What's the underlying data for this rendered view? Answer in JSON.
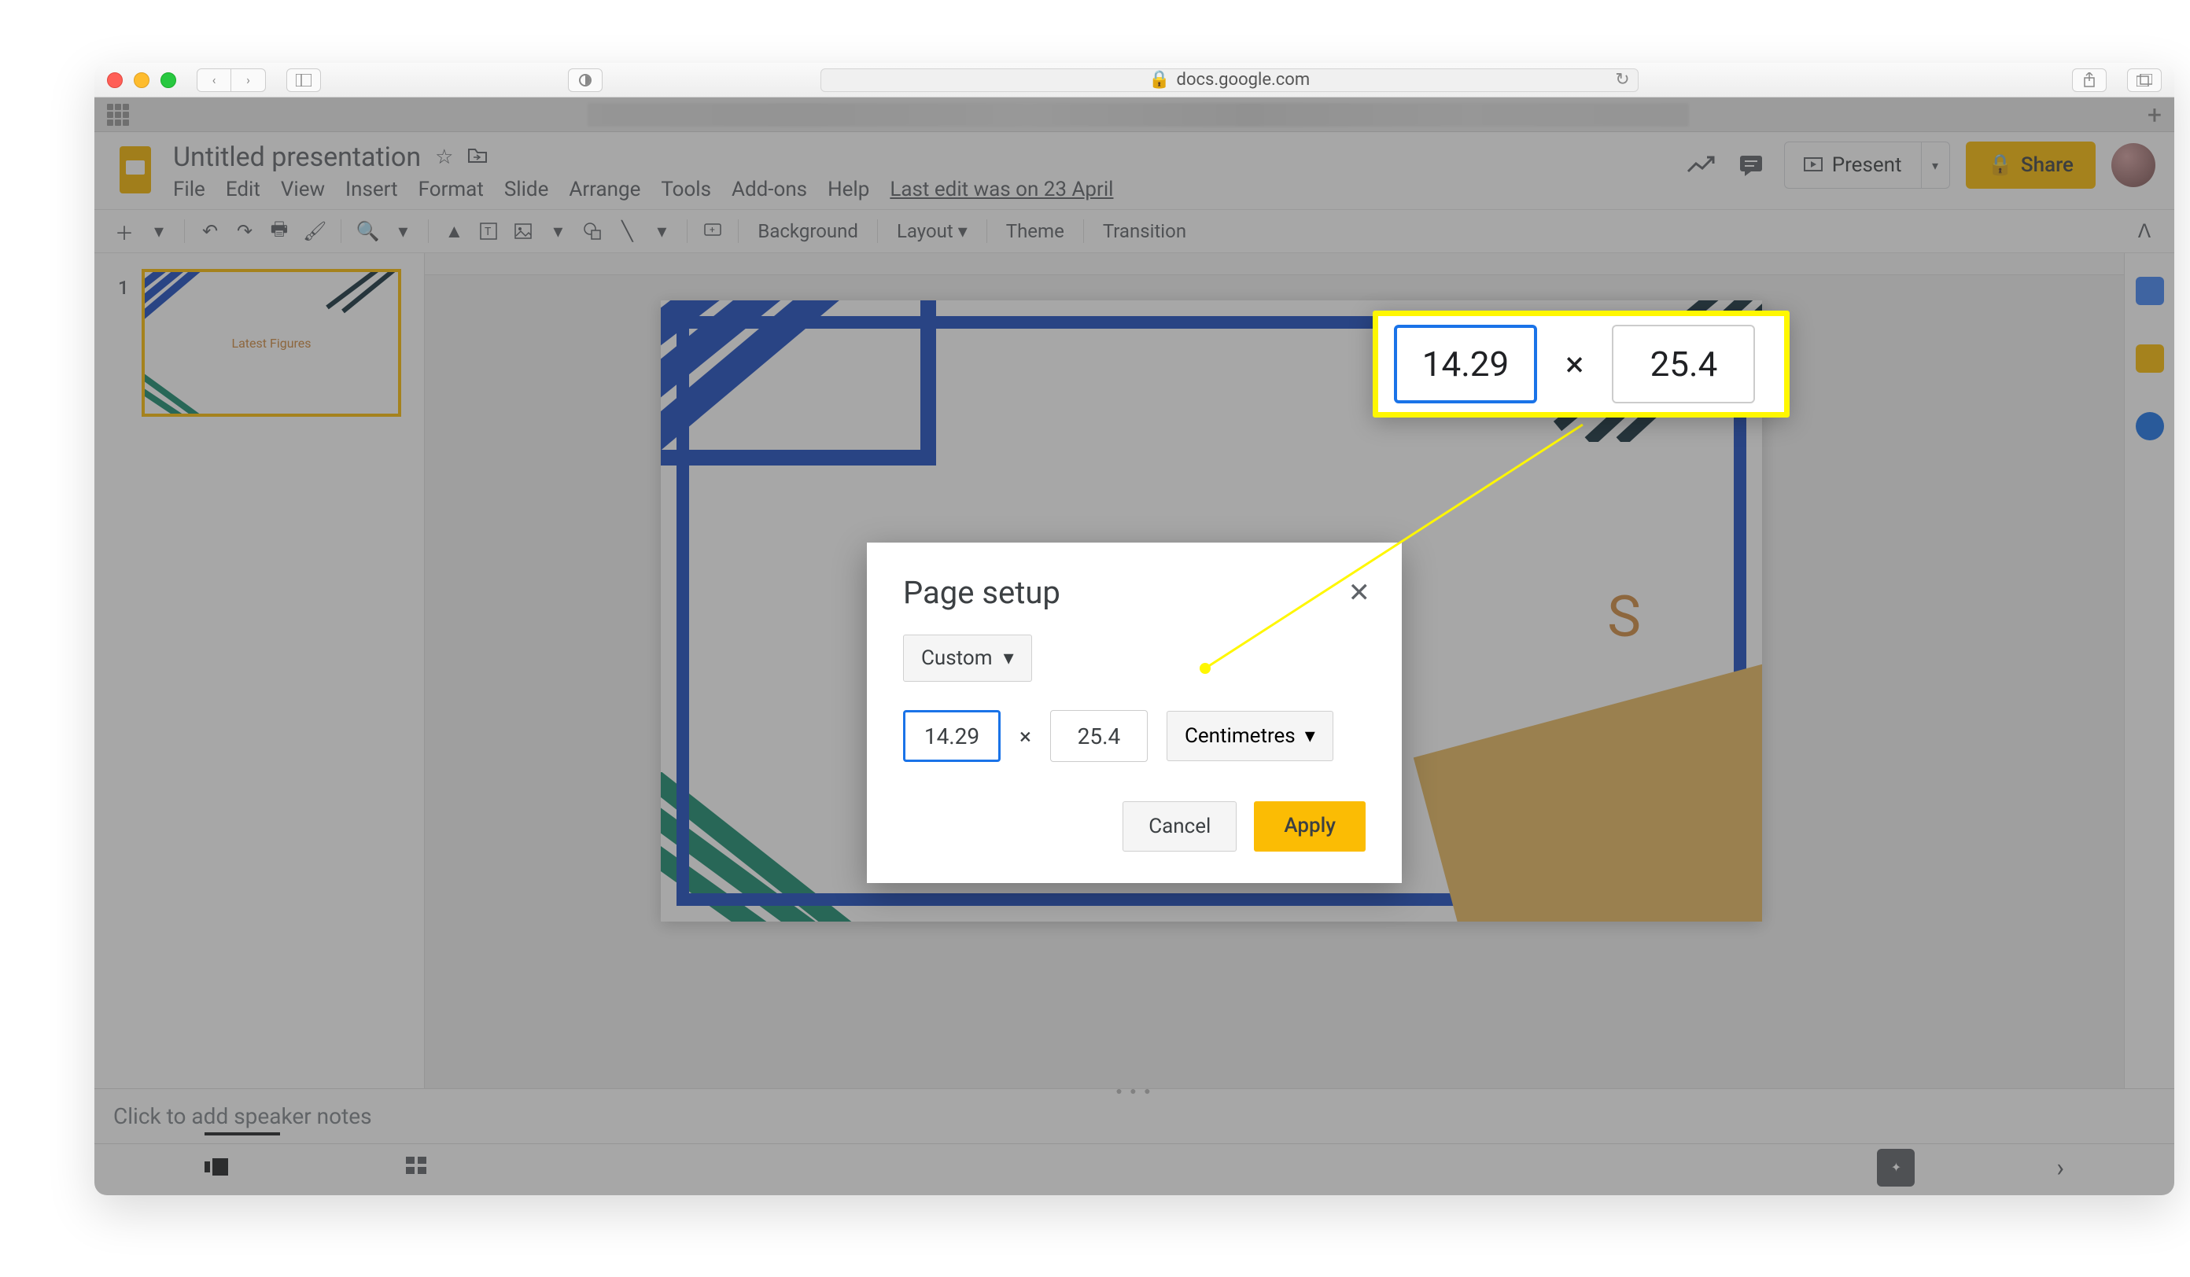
{
  "browser": {
    "url": "docs.google.com"
  },
  "document": {
    "title": "Untitled presentation",
    "last_edit": "Last edit was on 23 April"
  },
  "menu": {
    "file": "File",
    "edit": "Edit",
    "view": "View",
    "insert": "Insert",
    "format": "Format",
    "slide": "Slide",
    "arrange": "Arrange",
    "tools": "Tools",
    "addons": "Add-ons",
    "help": "Help"
  },
  "header_buttons": {
    "present": "Present",
    "share": "Share"
  },
  "toolbar": {
    "background": "Background",
    "layout": "Layout",
    "theme": "Theme",
    "transition": "Transition"
  },
  "filmstrip": {
    "slide_number": "1",
    "thumb_title": "Latest Figures"
  },
  "canvas": {
    "title_fragment": "S"
  },
  "speaker_notes_placeholder": "Click to add speaker notes",
  "modal": {
    "title": "Page setup",
    "size_dropdown": "Custom",
    "width": "14.29",
    "height": "25.4",
    "unit": "Centimetres",
    "cancel": "Cancel",
    "apply": "Apply",
    "x": "×"
  },
  "callout": {
    "width": "14.29",
    "height": "25.4",
    "x": "×"
  }
}
